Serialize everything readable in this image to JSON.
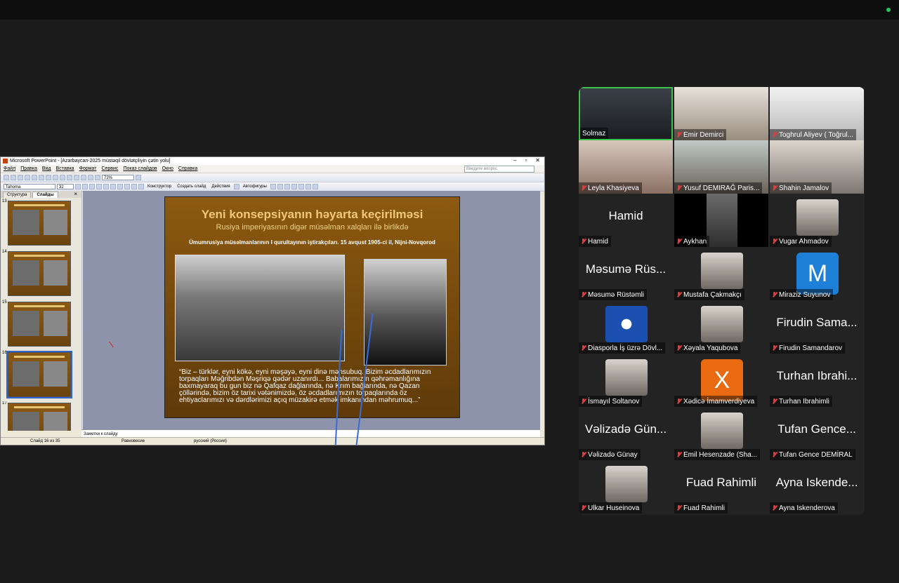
{
  "ppt": {
    "title": "Microsoft PowerPoint - [Azarbaycan-2025  müstəqil dövlətçiliyin çətin yolu]",
    "menu": [
      "Файл",
      "Правка",
      "Вид",
      "Вставка",
      "Формат",
      "Сервис",
      "Показ слайдов",
      "Окно",
      "Справка"
    ],
    "help_placeholder": "Введите вопрос",
    "font": "Tahoma",
    "font_size": "32",
    "zoom": "72%",
    "toolbar2": {
      "designer": "Конструктор",
      "create_slide": "Создать слайд",
      "actions": "Действия",
      "autoshapes": "Автофигуры"
    },
    "tabs": {
      "outline": "Структура",
      "slides": "Слайды"
    },
    "thumbnails": [
      "13",
      "14",
      "15",
      "16",
      "17"
    ],
    "slide": {
      "title": "Yeni konsepsiyanın həyarta keçirilməsi",
      "subtitle": "Rusiya imperiyasının digər müsəlman xalqları ilə birlikdə",
      "caption": "Ümumrusiya müsəlmanlarının I qurultayının iştirakçıları.  15 avqust 1905-ci il, Nijni-Novqorod",
      "quote": "“Biz – türklər, eyni kökə, eyni məşəyə, eyni dinə mənsubuq. Bizim əcdadlarımızın torpaqları Məğribdən Məşriqə qədər uzanırdı... Babalarımızın qəhrəmanlığına baxmayaraq bu gun biz nə Qafqaz dağlarında, nə Krım bağlarında, nə Qazan çöllərində, bizim öz tarixi vətənimizdə, öz əcdadlarımızın torpaqlarında öz ehtiyaclarımızı və dərdlərimizi açıq müzakirə etmək imkanından məhrumuq...”"
    },
    "notes_placeholder": "Заметки к слайду",
    "status": {
      "slide": "Слайд 16 из 35",
      "design": "Равновесие",
      "language": "русский (Россия)"
    }
  },
  "participants": [
    {
      "name": "Solmaz",
      "muted": false,
      "active": true
    },
    {
      "name": "Emir Demirci",
      "muted": true
    },
    {
      "name": "Toghrul Aliyev ( Toğrul...",
      "muted": true
    },
    {
      "name": "Leyla Khasiyeva",
      "muted": true
    },
    {
      "name": "Yusuf DEMIRAĞ Paris...",
      "muted": true
    },
    {
      "name": "Shahin Jamalov",
      "muted": true
    },
    {
      "name": "Hamid",
      "muted": true,
      "big": "Hamid"
    },
    {
      "name": "Aykhan",
      "muted": true
    },
    {
      "name": "Vugar Ahmadov",
      "muted": true
    },
    {
      "name": "Məsumə Rüstəmli",
      "muted": true,
      "big": "Məsumə Rüs..."
    },
    {
      "name": "Mustafa Çakmakçı",
      "muted": true
    },
    {
      "name": "Miraziz Suyunov",
      "muted": true,
      "letter": "M"
    },
    {
      "name": "Diasporla İş üzrə Dövl...",
      "muted": true
    },
    {
      "name": "Xəyala Yaqubova",
      "muted": true
    },
    {
      "name": "Firudin Samandarov",
      "muted": true,
      "big": "Firudin Sama..."
    },
    {
      "name": "İsmayıl Soltanov",
      "muted": true
    },
    {
      "name": "Xədicə İmamverdiyeva",
      "muted": true,
      "letter": "X"
    },
    {
      "name": "Turhan Ibrahimli",
      "muted": true,
      "big": "Turhan Ibrahi..."
    },
    {
      "name": "Vəlizadə Günay",
      "muted": true,
      "big": "Vəlizadə Gün..."
    },
    {
      "name": "Emil Hesenzade (Sha...",
      "muted": true
    },
    {
      "name": "Tufan Gence DEMİRAL",
      "muted": true,
      "big": "Tufan Gence..."
    },
    {
      "name": "Ulkar Huseinova",
      "muted": true
    },
    {
      "name": "Fuad Rahimli",
      "muted": true,
      "big": "Fuad Rahimli"
    },
    {
      "name": "Ayna Iskenderova",
      "muted": true,
      "big": "Ayna Iskende..."
    }
  ],
  "colors": {
    "active_speaker": "#3cc24a",
    "mute": "#e23c3c",
    "avatar_m": "#1e7fd6",
    "avatar_x": "#ea6a12"
  }
}
